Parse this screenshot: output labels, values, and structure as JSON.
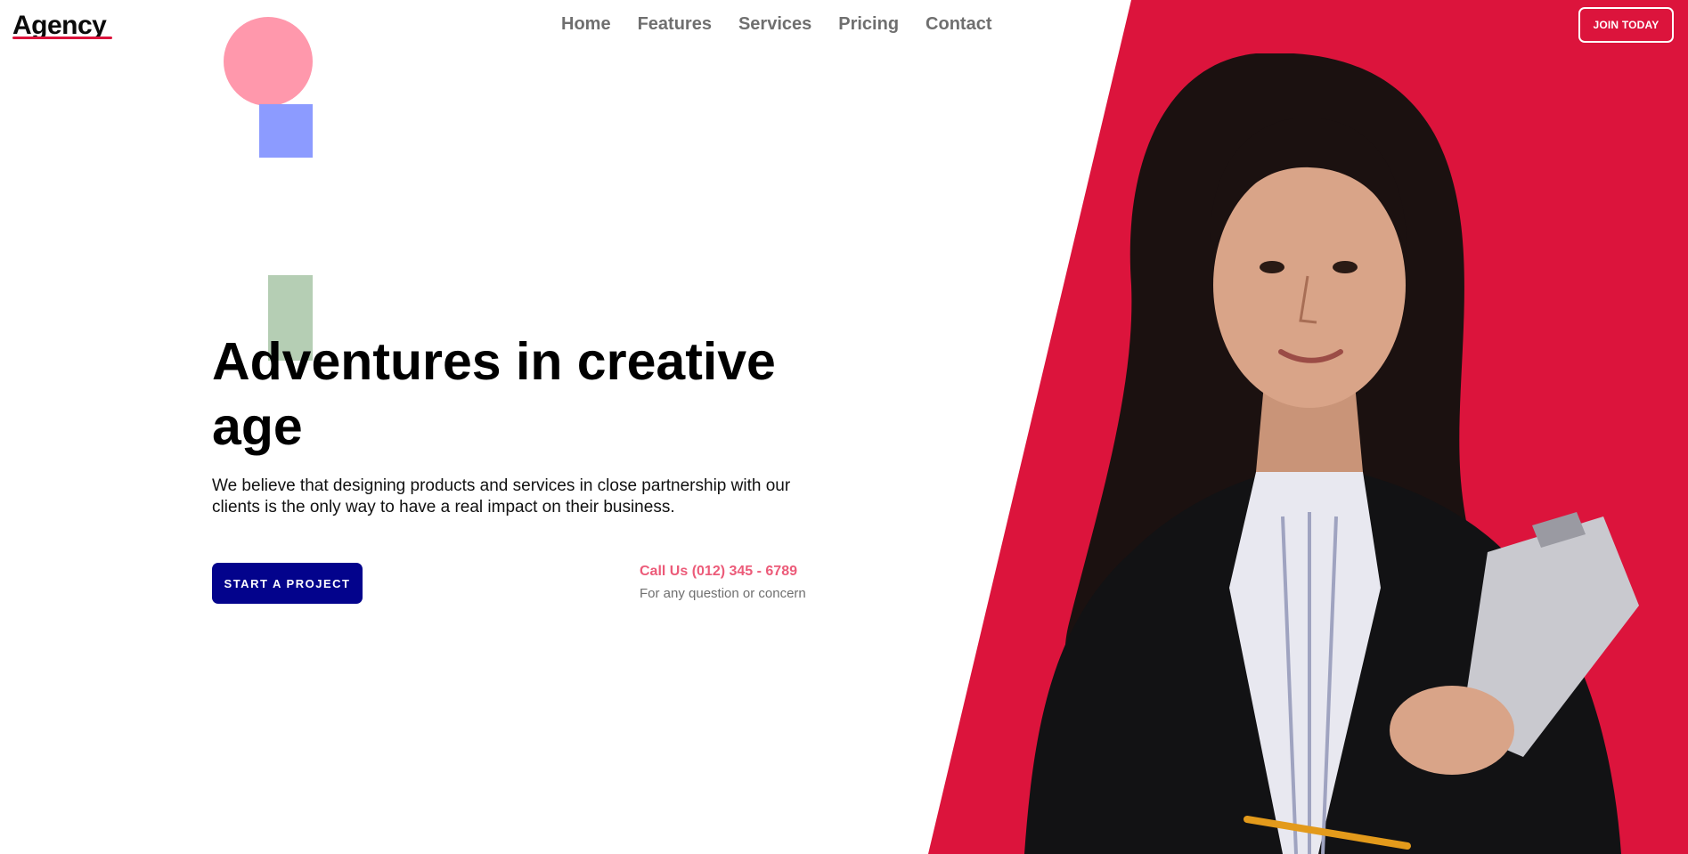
{
  "header": {
    "logo": "Agency",
    "nav": [
      "Home",
      "Features",
      "Services",
      "Pricing",
      "Contact"
    ],
    "join_label": "JOIN TODAY"
  },
  "hero": {
    "title_line1": "Adventures in creative",
    "title_line2": "age",
    "description_line1": "We believe that designing products and services in close partnership with our",
    "description_line2": "clients is the only way to have a real impact on their business.",
    "cta_label": "START A PROJECT",
    "call_us": "Call Us (012) 345 - 6789",
    "call_note": "For any question or concern"
  },
  "colors": {
    "accent_red": "#dc143c",
    "cta_navy": "#03038c",
    "shape_pink": "#ff98ac",
    "shape_blue": "#8c9bff",
    "shape_green": "#b5ceb4",
    "phone_pink": "#ec5b79"
  },
  "image": {
    "subject": "woman-holding-clipboard"
  }
}
